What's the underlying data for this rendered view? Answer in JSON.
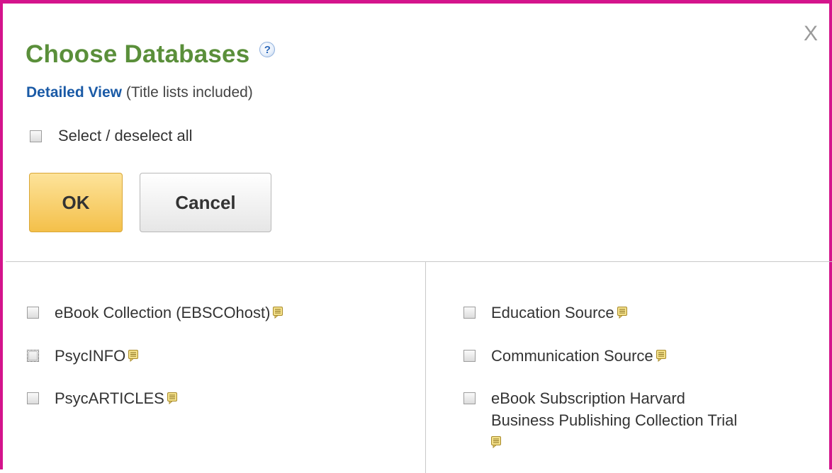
{
  "dialog": {
    "title": "Choose Databases",
    "help_symbol": "?",
    "close_label": "X",
    "detailed_view_link": "Detailed View",
    "detailed_view_note": "(Title lists included)",
    "select_all_label": "Select / deselect all",
    "ok_label": "OK",
    "cancel_label": "Cancel"
  },
  "databases": {
    "left": [
      {
        "label": "eBook Collection (EBSCOhost)",
        "checked": false
      },
      {
        "label": "PsycINFO",
        "checked": false
      },
      {
        "label": "PsycARTICLES",
        "checked": false
      }
    ],
    "right": [
      {
        "label": "Education Source",
        "checked": false
      },
      {
        "label": "Communication Source",
        "checked": false
      },
      {
        "label": "eBook Subscription Harvard",
        "label_line2": "Business Publishing Collection Trial",
        "checked": false
      }
    ]
  },
  "colors": {
    "frame_border": "#d4148c",
    "title": "#5a8f3a",
    "link": "#1a5aa6",
    "ok_button": "#f4c04a",
    "note_icon": "#c9a43a"
  }
}
